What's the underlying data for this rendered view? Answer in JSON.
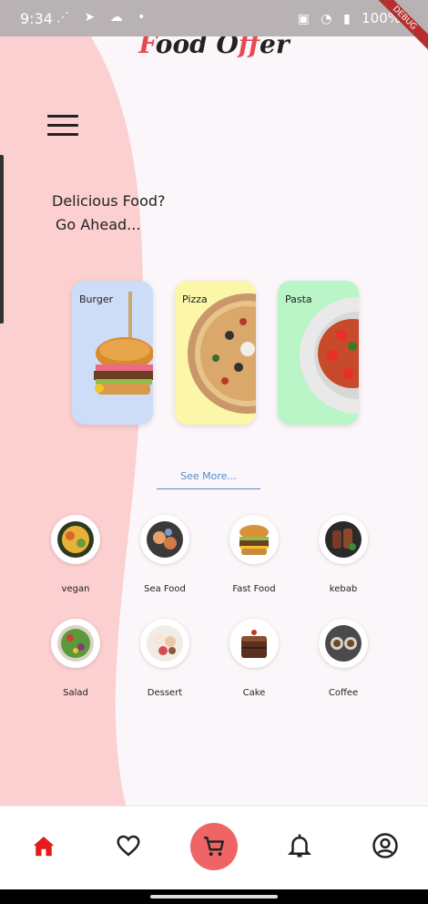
{
  "status_bar": {
    "time": "9:34",
    "battery": "100%",
    "debug_ribbon": "DEBUG"
  },
  "app": {
    "logo_part1": "F",
    "logo_part2": "ood O",
    "logo_part3": "ff",
    "logo_part4": "er"
  },
  "headline": {
    "line1": "Delicious Food?",
    "line2": "Go Ahead..."
  },
  "featured_cards": [
    {
      "label": "Burger",
      "bg": "#cdddf7"
    },
    {
      "label": "Pizza",
      "bg": "#fbf6a8"
    },
    {
      "label": "Pasta",
      "bg": "#b9f5c6"
    }
  ],
  "see_more": "See More...",
  "categories": [
    {
      "label": "vegan",
      "icon": "vegan-bowl-icon"
    },
    {
      "label": "Sea Food",
      "icon": "seafood-icon"
    },
    {
      "label": "Fast Food",
      "icon": "burger-icon"
    },
    {
      "label": "kebab",
      "icon": "kebab-icon"
    },
    {
      "label": "Salad",
      "icon": "salad-icon"
    },
    {
      "label": "Dessert",
      "icon": "dessert-icon"
    },
    {
      "label": "Cake",
      "icon": "cake-icon"
    },
    {
      "label": "Coffee",
      "icon": "coffee-icon"
    }
  ],
  "bottom_nav": [
    {
      "name": "home",
      "icon": "home-icon",
      "active": true
    },
    {
      "name": "favorites",
      "icon": "heart-icon"
    },
    {
      "name": "cart",
      "icon": "cart-icon"
    },
    {
      "name": "notifications",
      "icon": "bell-icon"
    },
    {
      "name": "profile",
      "icon": "account-circle-icon"
    }
  ],
  "colors": {
    "accent": "#ef6464",
    "left_panel": "#fccfd0",
    "background": "#fbf6f9",
    "link": "#4a8fd6",
    "home_active": "#e31b1b"
  }
}
